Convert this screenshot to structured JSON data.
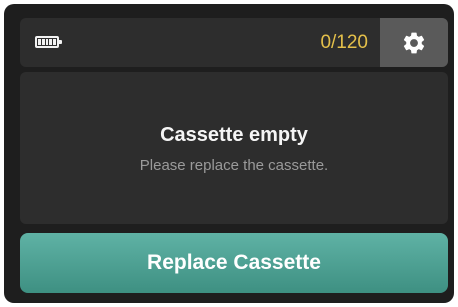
{
  "status_bar": {
    "battery_icon": "battery-full-icon",
    "battery_level": 1.0,
    "counter": "0/120",
    "counter_color": "#e4c04a",
    "settings_icon": "gear-icon"
  },
  "message_panel": {
    "title": "Cassette empty",
    "subtitle": "Please replace the cassette."
  },
  "action": {
    "label": "Replace Cassette",
    "color": "#4fa294"
  }
}
